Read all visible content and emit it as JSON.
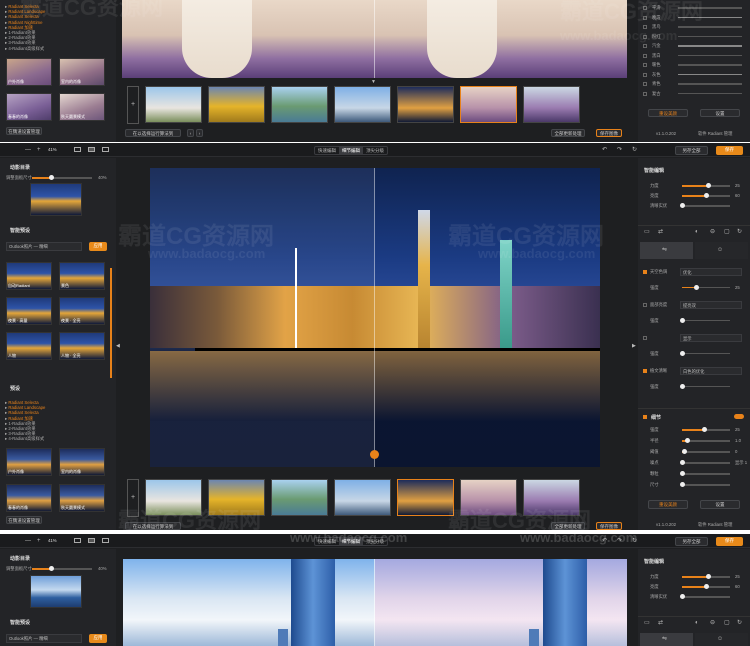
{
  "panel1": {
    "tree_items": [
      {
        "label": "Radiant Selecta",
        "orange": true
      },
      {
        "label": "Radiant Landscape",
        "orange": true
      },
      {
        "label": "Radiant Selecta",
        "orange": true
      },
      {
        "label": "Radiant Nighttime",
        "orange": true
      },
      {
        "label": "Radiant 加速",
        "orange": true
      },
      {
        "label": "1-Radiant效果",
        "orange": false
      },
      {
        "label": "2-Radiant效果",
        "orange": false
      },
      {
        "label": "3-Radiant效果",
        "orange": false
      },
      {
        "label": "4-Radiant高级样式",
        "orange": false
      }
    ],
    "presets": [
      "户外肖像",
      "室内的肖像",
      "春春的肖像",
      "秋天圆景模式"
    ],
    "open_btn": "在魏道设置管理",
    "bottom_left": "在以选择运行算法到",
    "page_nums": [
      "‹",
      "›"
    ],
    "btn_open_all": "全部更新处理",
    "btn_save": "保存图像",
    "version": "v.1.1.0.202",
    "rs_items": [
      "平滑",
      "晚霞",
      "黑鸟",
      "粉红",
      "汽金",
      "黑白",
      "暖色",
      "灰色",
      "青色",
      "复古"
    ],
    "rs_btn_left": "重设美颜",
    "rs_btn_right": "设置",
    "rs_footer_left": "v1.1.0.202",
    "rs_footer_right": "软件 Radiant 管理"
  },
  "panel2": {
    "zoom": "41%",
    "zoom_minus": "—",
    "zoom_plus": "+",
    "tabs": [
      "快速编辑",
      "细节编辑",
      "顶尖分级"
    ],
    "btn_export": "另存全部",
    "btn_save": "保存",
    "nav_title": "动影目录",
    "nav_label": "调整面板尺寸",
    "nav_value": "40%",
    "smart_title": "智能预设",
    "preset_select": "Outlook照片 — 精细",
    "preset_apply": "应用",
    "smart_presets": [
      "自动Radiant",
      "景色",
      "夜景 · 高量",
      "夜景 · 全亮",
      "人物",
      "人物 · 全亮"
    ],
    "presets_title": "预设",
    "tree_items": [
      {
        "label": "Radiant Selecta",
        "orange": true
      },
      {
        "label": "Radiant Landscape",
        "orange": true
      },
      {
        "label": "Radiant Selecta",
        "orange": true
      },
      {
        "label": "Radiant 加速",
        "orange": true
      },
      {
        "label": "1-Radiant效果",
        "orange": false
      },
      {
        "label": "2-Radiant效果",
        "orange": false
      },
      {
        "label": "3-Radiant效果",
        "orange": false
      },
      {
        "label": "4-Radiant高级样式",
        "orange": false
      }
    ],
    "bottom_presets": [
      "户外肖像",
      "室内的肖像",
      "春春的肖像",
      "秋天圆景模式"
    ],
    "open_btn": "在魏道设置管理",
    "bottom_left": "在以选择运行算法到",
    "btn_open_all": "全部更新处理",
    "btn_save_img": "保存图像",
    "right_title": "智能编辑",
    "sliders_top": [
      {
        "label": "力度",
        "value": "25",
        "pct": 0.55
      },
      {
        "label": "亮度",
        "value": "60",
        "pct": 0.5
      },
      {
        "label": "清晰实优",
        "value": "",
        "pct": 0.0
      }
    ],
    "rs_mid": [
      {
        "label": "天空色调",
        "value": "优化",
        "type": "select"
      },
      {
        "label": "强度",
        "value": "25",
        "type": "slider"
      },
      {
        "label": "面部亮度",
        "value": "提亮双",
        "type": "select"
      },
      {
        "label": "强度",
        "value": "",
        "type": "slider"
      },
      {
        "label": "",
        "value": "显示",
        "type": "select"
      },
      {
        "label": "强度",
        "value": "",
        "type": "slider"
      },
      {
        "label": "植文清晰",
        "value": "白色的优化",
        "type": "select"
      },
      {
        "label": "强度",
        "value": "",
        "type": "slider"
      }
    ],
    "detail_title": "细节",
    "detail_sliders": [
      {
        "label": "强度",
        "value": "25",
        "pct": 0.45
      },
      {
        "label": "半径",
        "value": "1.0",
        "pct": 0.1
      },
      {
        "label": "阈值",
        "value": "0",
        "pct": 0.05
      },
      {
        "label": "噪点",
        "value": "显示 1",
        "pct": 0.0
      },
      {
        "label": "颗粒",
        "value": "",
        "pct": 0.0
      },
      {
        "label": "尺寸",
        "value": "",
        "pct": 0.0
      }
    ],
    "rs_btn_left": "重设美颜",
    "rs_btn_right": "设置",
    "rs_footer_left": "v1.1.0.202",
    "rs_footer_right": "软件 Radiant 管理"
  },
  "panel3": {
    "zoom": "41%",
    "tabs": [
      "快速编辑",
      "细节编辑",
      "顶尖分级"
    ],
    "btn_export": "另存全部",
    "btn_save": "保存",
    "nav_title": "动影目录",
    "nav_label": "调整面板尺寸",
    "nav_value": "40%",
    "smart_title": "智能预设",
    "preset_select": "Outlook照片 — 精细",
    "preset_apply": "应用",
    "right_title": "智能编辑",
    "sliders_top": [
      {
        "label": "力度",
        "value": "25",
        "pct": 0.55
      },
      {
        "label": "亮度",
        "value": "60",
        "pct": 0.5
      },
      {
        "label": "清晰实优",
        "value": "",
        "pct": 0.0
      }
    ]
  },
  "watermark": {
    "big": "霸道CG资源网",
    "url": "www.badaocg.com"
  }
}
